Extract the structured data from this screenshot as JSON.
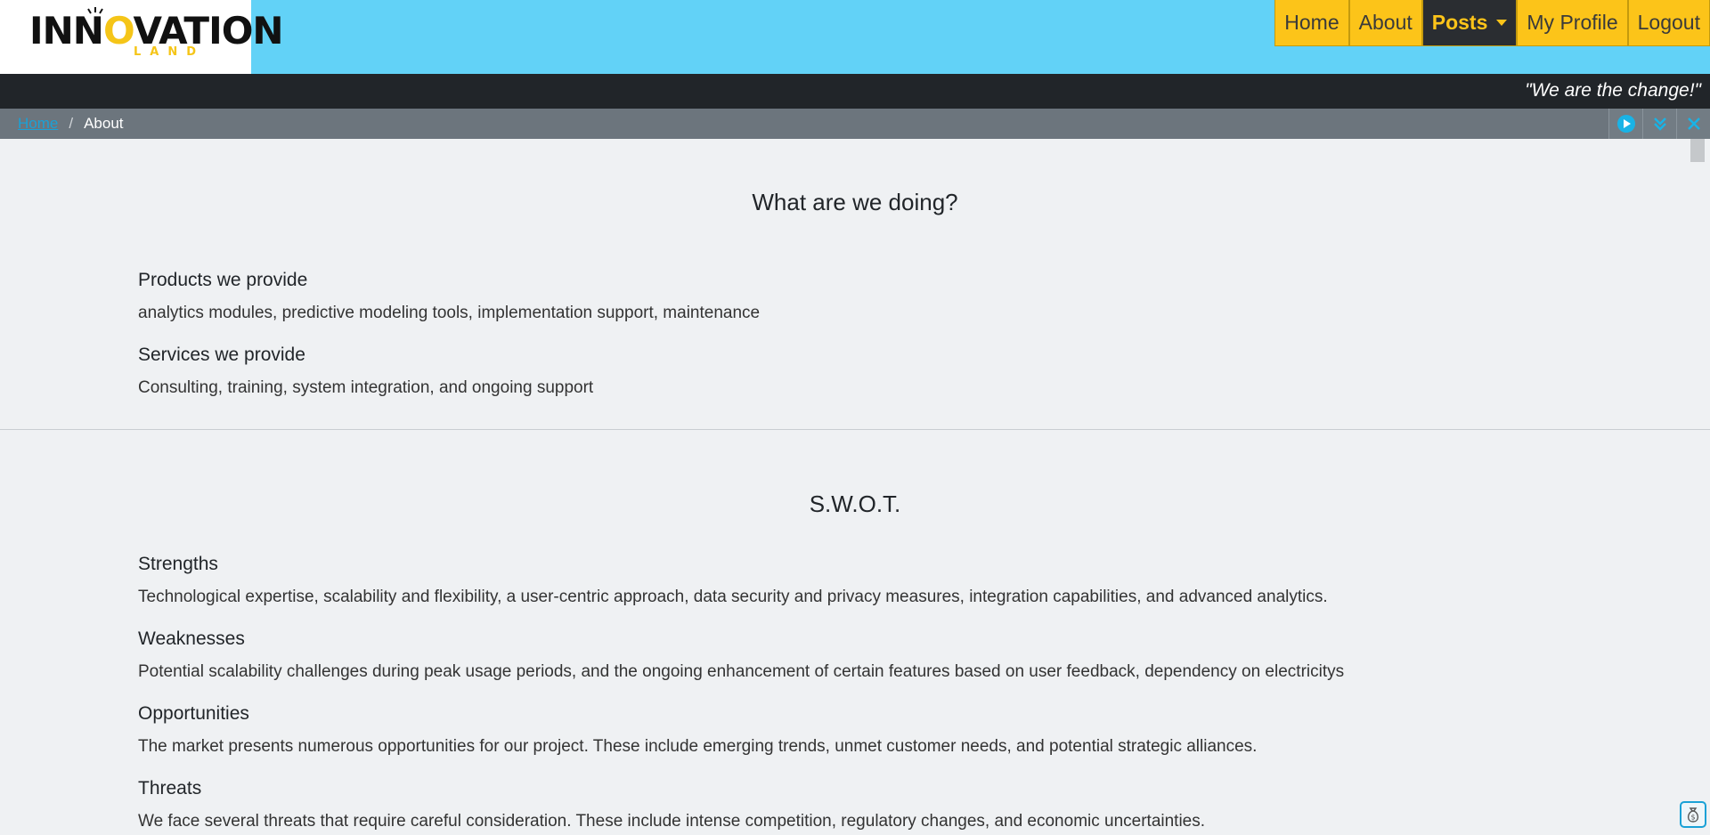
{
  "logo": {
    "text_before": "INN",
    "text_o": "O",
    "text_after": "VATION",
    "sub": "LAND"
  },
  "nav": {
    "items": [
      {
        "label": "Home"
      },
      {
        "label": "About"
      },
      {
        "label": "Posts"
      },
      {
        "label": "My Profile"
      },
      {
        "label": "Logout"
      }
    ]
  },
  "slogan": "\"We are the change!\"",
  "breadcrumb": {
    "home": "Home",
    "separator": "/",
    "current": "About"
  },
  "doing": {
    "heading": "What are we doing?",
    "products_title": "Products we provide",
    "products_text": "analytics modules, predictive modeling tools, implementation support, maintenance",
    "services_title": "Services we provide",
    "services_text": "Consulting, training, system integration, and ongoing support"
  },
  "swot": {
    "heading": "S.W.O.T.",
    "items": [
      {
        "title": "Strengths",
        "text": "Technological expertise, scalability and flexibility, a user-centric approach, data security and privacy measures, integration capabilities, and advanced analytics."
      },
      {
        "title": "Weaknesses",
        "text": "Potential scalability challenges during peak usage periods, and the ongoing enhancement of certain features based on user feedback, dependency on electricitys"
      },
      {
        "title": "Opportunities",
        "text": "The market presents numerous opportunities for our project. These include emerging trends, unmet customer needs, and potential strategic alliances."
      },
      {
        "title": "Threats",
        "text": "We face several threats that require careful consideration. These include intense competition, regulatory changes, and economic uncertainties."
      }
    ]
  },
  "colors": {
    "header_bg": "#62d2f7",
    "nav_bg": "#fcc419",
    "dark": "#212529",
    "breadcrumb_bg": "#6c757d",
    "page_bg": "#eff1f3"
  },
  "icons": [
    "play-icon",
    "double-chevron-down-icon",
    "close-icon",
    "money-bag-icon"
  ]
}
